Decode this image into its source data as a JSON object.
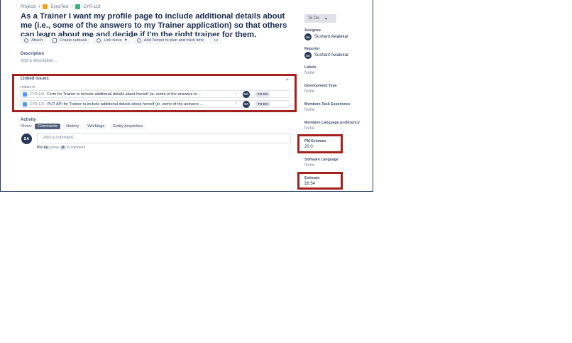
{
  "breadcrumb": {
    "projects": "Projects",
    "sep1": "/",
    "project_name": "CyretTest",
    "sep2": "/",
    "issue_key": "CYR-118"
  },
  "issue": {
    "title": "As a Trainer I want my profile page to include additional details about me (i.e., some of the answers to my Trainer application) so that others can learn about me and decide if I'm the right trainer for them."
  },
  "toolbar": {
    "attach": "Attach",
    "create_subtask": "Create subtask",
    "link_issue": "Link issue",
    "tempo": "Add Tempo to plan and track time",
    "more": "•••"
  },
  "description": {
    "label": "Description",
    "placeholder": "Add a description..."
  },
  "linked_issues": {
    "label": "Linked issues",
    "add": "+",
    "relation": "relates to",
    "items": [
      {
        "key": "CYR-119",
        "summary": "Form for Trainer to include additional details about herself (ie. some of the answers to ...",
        "priority_icon": "arrow-up-icon",
        "avatar": "SA",
        "status": "TO DO"
      },
      {
        "key": "CYR-120",
        "summary": "PUT API for Trainer to include additional details about herself (ie. some of the answers ...",
        "priority_icon": "arrow-up-icon",
        "avatar": "SA",
        "status": "TO DO"
      }
    ]
  },
  "activity": {
    "label": "Activity",
    "show_label": "Show:",
    "tabs": [
      "Comments",
      "History",
      "Worklogs",
      "Entity properties"
    ],
    "active_tab": "Comments",
    "avatar": "SA",
    "comment_placeholder": "Add a comment...",
    "pro_tip_label": "Pro tip:",
    "pro_tip_pre": "press",
    "pro_tip_key": "M",
    "pro_tip_post": "to comment"
  },
  "sidebar": {
    "status": "To Do",
    "assignee_label": "Assignee",
    "assignee_avatar": "SA",
    "assignee_name": "Sushant Awalekar",
    "reporter_label": "Reporter",
    "reporter_avatar": "SA",
    "reporter_name": "Sushant Awalekar",
    "labels_label": "Labels",
    "labels_value": "None",
    "devtype_label": "Development Type",
    "devtype_value": "None",
    "members_task_label": "Members Task Experience",
    "members_task_value": "None",
    "members_lang_label": "Members Language proficiency",
    "members_lang_value": "None",
    "pm_estimate_label": "PM Estimate",
    "pm_estimate_value": "20:0",
    "software_lang_label": "Software Language",
    "software_lang_value": "None",
    "estimate_label": "Estimate",
    "estimate_value": "16:54"
  },
  "colors": {
    "highlight": "#a3211e",
    "avatar": "#253858",
    "priority": "#ff7452",
    "checkbox": "#4c9aff"
  }
}
